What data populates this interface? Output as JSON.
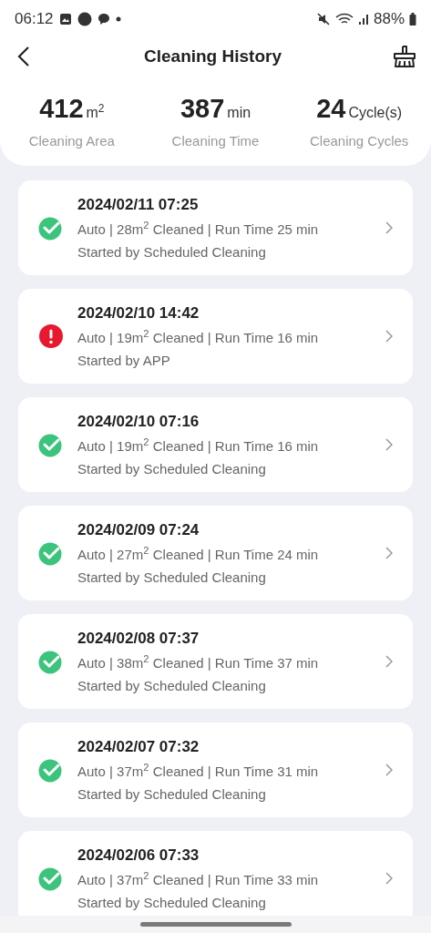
{
  "status_bar": {
    "time": "06:12",
    "battery": "88%"
  },
  "header": {
    "title": "Cleaning History"
  },
  "stats": [
    {
      "value": "412",
      "unit": "m$^{2}$",
      "label": "Cleaning Area"
    },
    {
      "value": "387",
      "unit": "min",
      "label": "Cleaning Time"
    },
    {
      "value": "24",
      "unit": "Cycle(s)",
      "label": "Cleaning Cycles"
    }
  ],
  "records": [
    {
      "kind": "success",
      "datetime": "2024/02/11 07:25",
      "summary": "Auto | 28m$^{2}$ Cleaned | Run Time 25 min",
      "source": "Started by Scheduled Cleaning"
    },
    {
      "kind": "error",
      "datetime": "2024/02/10 14:42",
      "summary": "Auto | 19m$^{2}$ Cleaned | Run Time 16 min",
      "source": "Started by APP"
    },
    {
      "kind": "success",
      "datetime": "2024/02/10 07:16",
      "summary": "Auto | 19m$^{2}$ Cleaned | Run Time 16 min",
      "source": "Started by Scheduled Cleaning"
    },
    {
      "kind": "success",
      "datetime": "2024/02/09 07:24",
      "summary": "Auto | 27m$^{2}$ Cleaned | Run Time 24 min",
      "source": "Started by Scheduled Cleaning"
    },
    {
      "kind": "success",
      "datetime": "2024/02/08 07:37",
      "summary": "Auto | 38m$^{2}$ Cleaned | Run Time 37 min",
      "source": "Started by Scheduled Cleaning"
    },
    {
      "kind": "success",
      "datetime": "2024/02/07 07:32",
      "summary": "Auto | 37m$^{2}$ Cleaned | Run Time 31 min",
      "source": "Started by Scheduled Cleaning"
    },
    {
      "kind": "success",
      "datetime": "2024/02/06 07:33",
      "summary": "Auto | 37m$^{2}$ Cleaned | Run Time 33 min",
      "source": "Started by Scheduled Cleaning"
    }
  ]
}
